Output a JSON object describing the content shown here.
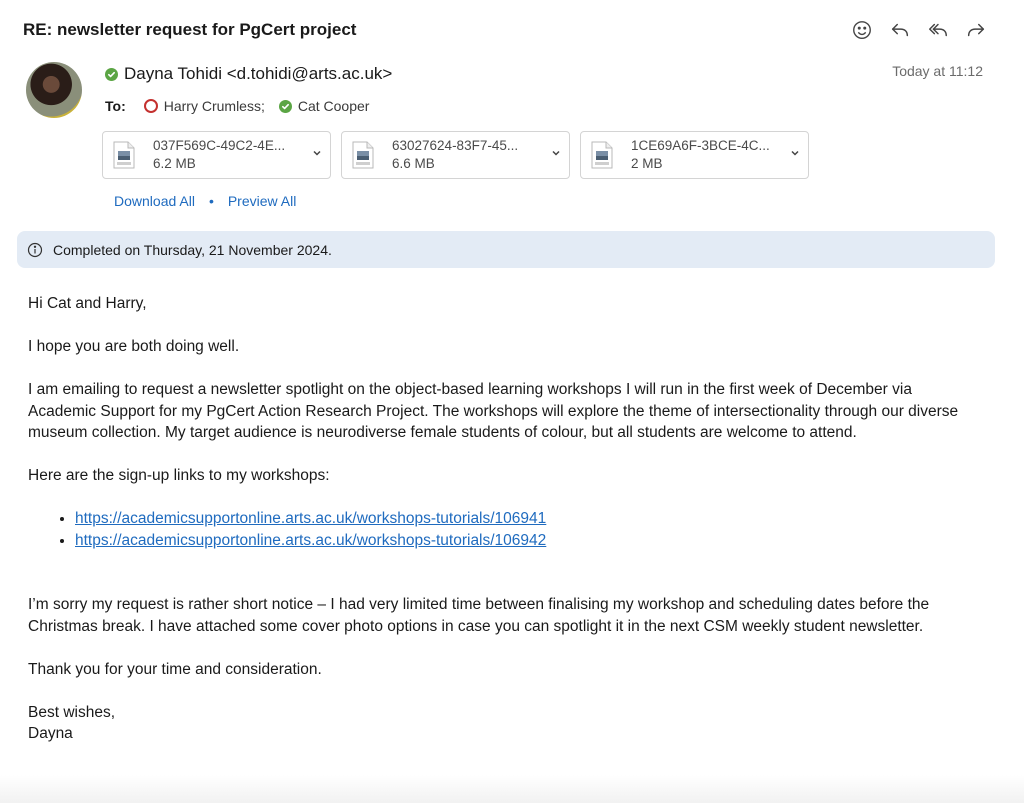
{
  "email": {
    "subject": "RE: newsletter request for PgCert project",
    "sender": "Dayna Tohidi <d.tohidi@arts.ac.uk>",
    "date": "Today at 11:12",
    "to_label": "To:",
    "recipients": [
      {
        "name": "Harry Crumless;",
        "status": "busy"
      },
      {
        "name": "Cat Cooper",
        "status": "available"
      }
    ]
  },
  "attachments": [
    {
      "name": "037F569C-49C2-4E...",
      "size": "6.2 MB",
      "icon": "jpeg-file-icon"
    },
    {
      "name": "63027624-83F7-45...",
      "size": "6.6 MB",
      "icon": "jpeg-file-icon"
    },
    {
      "name": "1CE69A6F-3BCE-4C...",
      "size": "2 MB",
      "icon": "jpeg-file-icon"
    }
  ],
  "attachment_actions": {
    "download_all": "Download All",
    "separator": "•",
    "preview_all": "Preview All"
  },
  "banner": {
    "text": "Completed on Thursday, 21 November 2024.",
    "icon": "info-icon"
  },
  "body": {
    "greeting": "Hi Cat and Harry,",
    "p1": "I hope you are both doing well.",
    "p2": "I am emailing to request a newsletter spotlight on the object-based learning workshops I will run in the first week of December via Academic Support for my PgCert Action Research Project. The workshops will explore the theme of intersectionality through our diverse museum collection. My target audience is neurodiverse female students of colour, but all students are welcome to attend.",
    "p3": "Here are the sign-up links to my workshops:",
    "links": [
      "https://academicsupportonline.arts.ac.uk/workshops-tutorials/106941",
      "https://academicsupportonline.arts.ac.uk/workshops-tutorials/106942"
    ],
    "p4": "I’m sorry my request is rather short notice – I had very limited time between finalising my workshop and scheduling dates before the Christmas break. I have attached some cover photo options in case you can spotlight it in the next CSM weekly student newsletter.",
    "p5": "Thank you for your time and consideration.",
    "signoff": "Best wishes,",
    "signature": "Dayna"
  },
  "toolbar": {
    "icons": [
      "emoji-icon",
      "reply-icon",
      "reply-all-icon",
      "forward-icon"
    ]
  },
  "colors": {
    "link": "#1f6bbf",
    "banner_bg": "#e3ebf5",
    "available": "#5ba544",
    "busy": "#c4312f"
  }
}
